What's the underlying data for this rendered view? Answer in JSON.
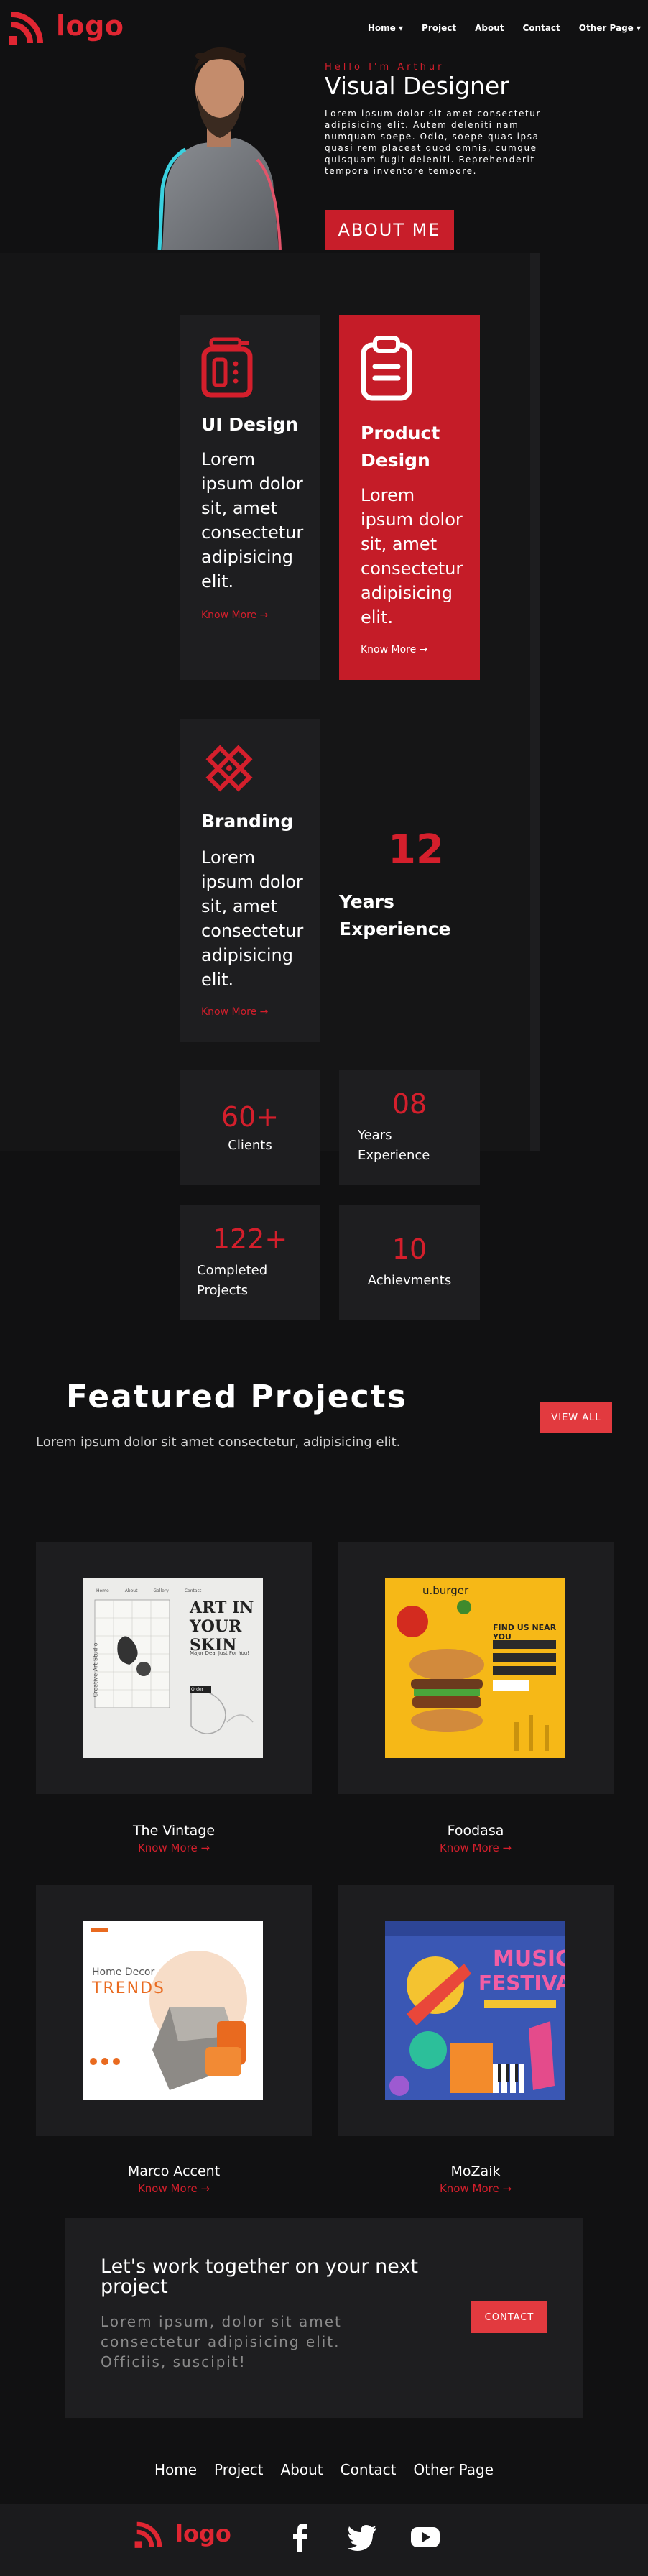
{
  "brand": {
    "logo_text": "logo",
    "accent": "#d41f2c"
  },
  "nav": {
    "items": [
      "Home ▾",
      "Project",
      "About",
      "Contact",
      "Other Page ▾"
    ]
  },
  "hero": {
    "greeting": "Hello I'm Arthur",
    "title": "Visual Designer",
    "description": "Lorem ipsum dolor sit amet consectetur adipisicing elit. Autem deleniti nam numquam soepe. Odio, soepe quas ipsa quasi rem placeat quod omnis, cumque quisquam fugit deleniti. Reprehenderit tempora inventore tempore.",
    "cta_label": "ABOUT ME"
  },
  "services": [
    {
      "title": "UI Design",
      "text": "Lorem ipsum dolor sit, amet consectetur adipisicing elit.",
      "link": "Know More →",
      "icon": "calculator-icon"
    },
    {
      "title": "Product Design",
      "text": "Lorem ipsum dolor sit, amet consectetur adipisicing elit.",
      "link": "Know More →",
      "icon": "clipboard-icon"
    },
    {
      "title": "Branding",
      "text": "Lorem ipsum dolor sit, amet consectetur adipisicing elit.",
      "link": "Know More →",
      "icon": "ruler-pencil-icon"
    }
  ],
  "experience": {
    "number": "12",
    "label": "Years Experience"
  },
  "stats": [
    {
      "value": "60+",
      "label": "Clients"
    },
    {
      "value": "08",
      "label": "Years Experience"
    },
    {
      "value": "122+",
      "label": "Completed Projects"
    },
    {
      "value": "10",
      "label": "Achievments"
    }
  ],
  "featured": {
    "title": "Featured Projects",
    "subtitle": "Lorem ipsum dolor sit amet consectetur, adipisicing elit.",
    "view_all": "VIEW ALL",
    "projects": [
      {
        "name": "The Vintage",
        "link": "Know More →",
        "thumb_heading": "ART IN YOUR SKIN",
        "thumb_side": "Creative Art Studio",
        "thumb_sub": "Major Deal Just For You!",
        "thumb_nav": [
          "Home",
          "About",
          "Gallery",
          "Contact"
        ],
        "thumb_btn": "Order"
      },
      {
        "name": "Foodasa",
        "link": "Know More →",
        "thumb_brand": "u.burger",
        "thumb_heading": "FIND US NEAR YOU"
      },
      {
        "name": "Marco Accent",
        "link": "Know More →",
        "thumb_heading_1": "Home Decor",
        "thumb_heading_2": "TRENDS"
      },
      {
        "name": "MoZaik",
        "link": "Know More →",
        "thumb_heading_1": "MUSIC",
        "thumb_heading_2": "FESTIVAL"
      }
    ]
  },
  "cta": {
    "title": "Let's work together on your next project",
    "text": "Lorem ipsum, dolor sit amet consectetur adipisicing elit. Officiis, suscipit!",
    "button": "CONTACT"
  },
  "footer": {
    "nav": [
      "Home",
      "Project",
      "About",
      "Contact",
      "Other Page"
    ],
    "logo_text": "logo",
    "social": [
      "facebook-icon",
      "twitter-icon",
      "youtube-icon"
    ]
  }
}
